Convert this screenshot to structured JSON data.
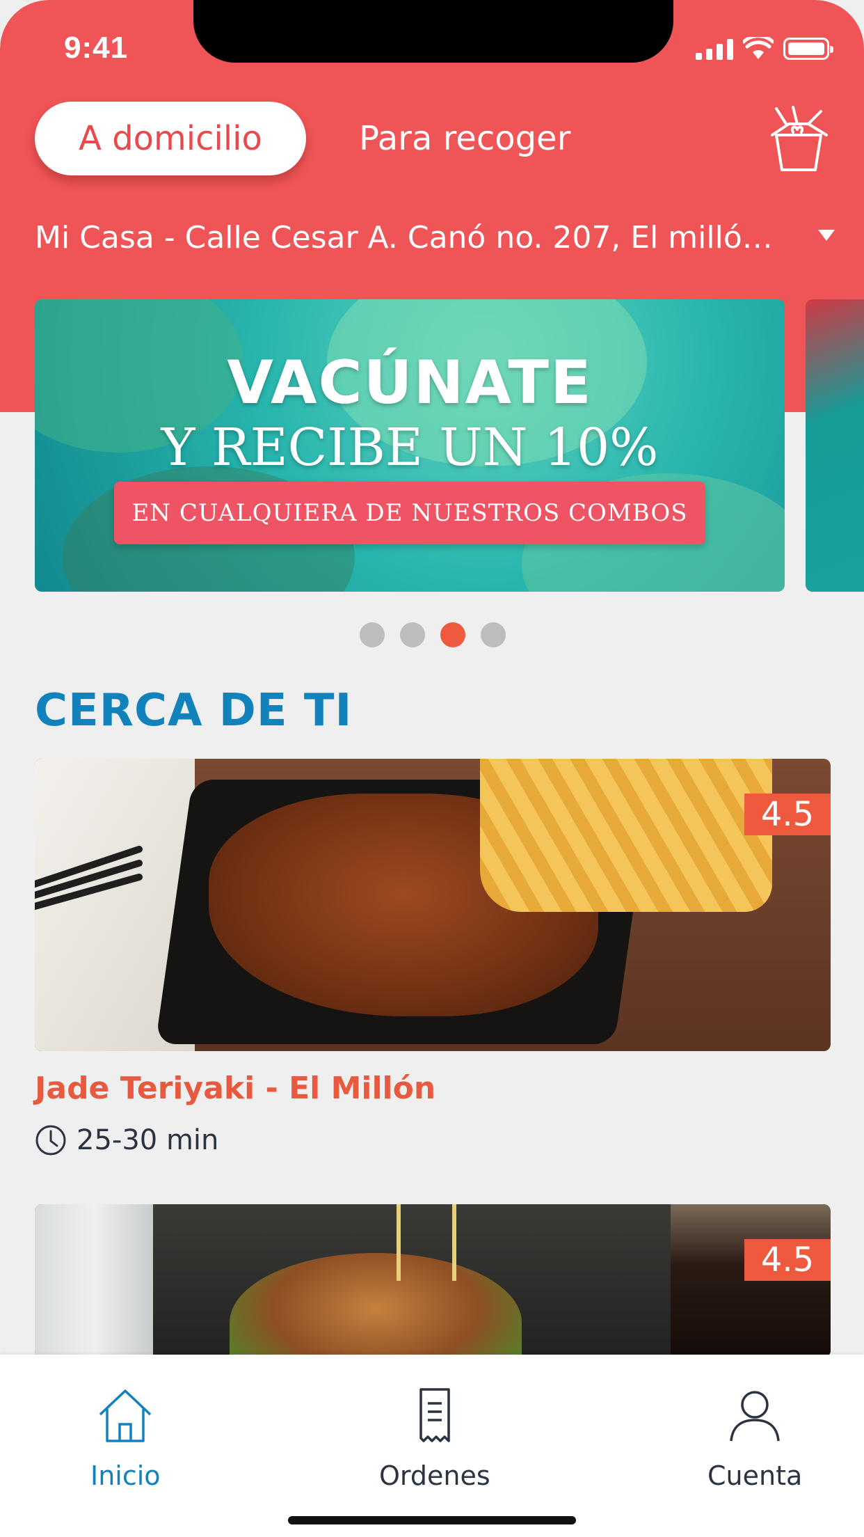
{
  "status_bar": {
    "time": "9:41"
  },
  "header": {
    "mode_selected": "A domicilio",
    "mode_other": "Para recoger",
    "address": "Mi Casa - Calle Cesar A. Canó no. 207, El millón..."
  },
  "banner": {
    "title": "VACÚNATE",
    "subtitle": "Y RECIBE UN 10%",
    "tag": "EN CUALQUIERA DE NUESTROS COMBOS",
    "dots_count": 4,
    "active_dot": 3
  },
  "section": {
    "title": "CERCA DE TI"
  },
  "restaurants": [
    {
      "name": "Jade Teriyaki - El Millón",
      "time": "25-30 min",
      "rating": "4.5"
    },
    {
      "rating": "4.5"
    }
  ],
  "tabs": [
    {
      "label": "Inicio",
      "icon": "home-icon",
      "active": true
    },
    {
      "label": "Ordenes",
      "icon": "receipt-icon",
      "active": false
    },
    {
      "label": "Cuenta",
      "icon": "user-icon",
      "active": false
    }
  ],
  "colors": {
    "header_red": "#ef5556",
    "accent_orange": "#ef5a3f",
    "brand_blue": "#1282bd",
    "background": "#efefef"
  }
}
